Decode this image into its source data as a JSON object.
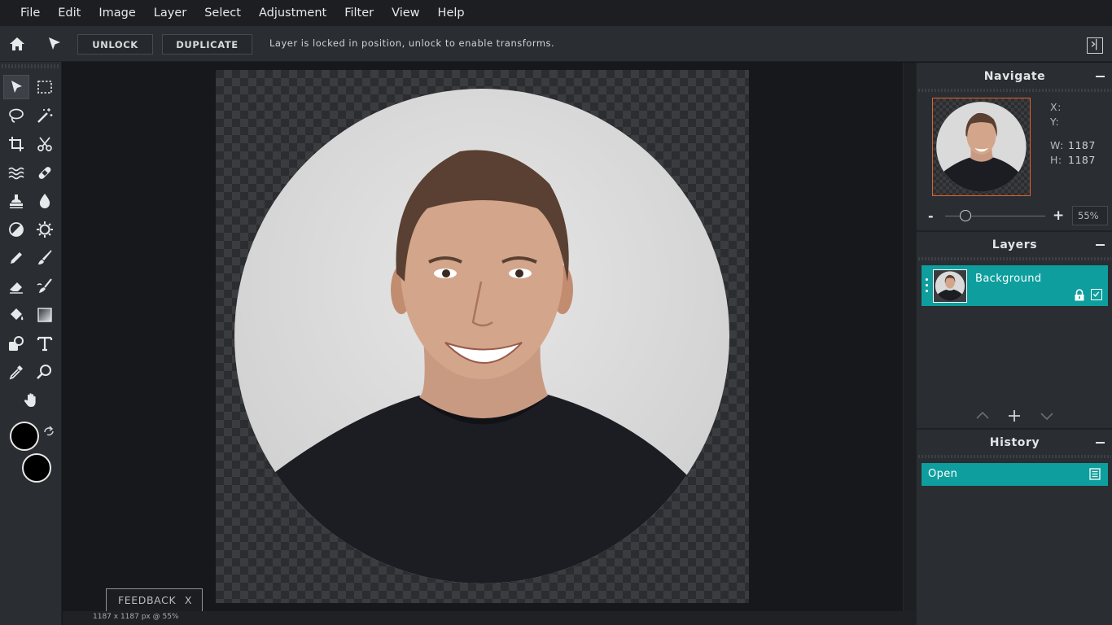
{
  "menu": [
    "File",
    "Edit",
    "Image",
    "Layer",
    "Select",
    "Adjustment",
    "Filter",
    "View",
    "Help"
  ],
  "options": {
    "unlock_label": "UNLOCK",
    "duplicate_label": "DUPLICATE",
    "message": "Layer is locked in position, unlock to enable transforms."
  },
  "tools": [
    {
      "name": "move-tool",
      "icon": "cursor-arrow-icon",
      "active": true
    },
    {
      "name": "marquee-tool",
      "icon": "dashed-rect-icon"
    },
    {
      "name": "lasso-tool",
      "icon": "lasso-icon"
    },
    {
      "name": "magic-wand-tool",
      "icon": "magic-wand-icon"
    },
    {
      "name": "crop-tool",
      "icon": "crop-icon"
    },
    {
      "name": "cut-tool",
      "icon": "scissors-icon"
    },
    {
      "name": "liquify-tool",
      "icon": "waves-icon"
    },
    {
      "name": "heal-tool",
      "icon": "bandage-icon"
    },
    {
      "name": "clone-stamp-tool",
      "icon": "stamp-icon"
    },
    {
      "name": "blur-tool",
      "icon": "drop-icon"
    },
    {
      "name": "dodge-tool",
      "icon": "half-circle-icon"
    },
    {
      "name": "sponge-tool",
      "icon": "sun-gear-icon"
    },
    {
      "name": "pencil-tool",
      "icon": "pencil-icon"
    },
    {
      "name": "brush-tool",
      "icon": "brush-icon"
    },
    {
      "name": "eraser-tool",
      "icon": "eraser-icon"
    },
    {
      "name": "smudge-tool",
      "icon": "smudge-brush-icon"
    },
    {
      "name": "fill-tool",
      "icon": "paint-bucket-icon"
    },
    {
      "name": "gradient-tool",
      "icon": "gradient-icon"
    },
    {
      "name": "shape-tool",
      "icon": "shapes-icon"
    },
    {
      "name": "text-tool",
      "icon": "text-icon"
    },
    {
      "name": "eyedropper-tool",
      "icon": "eyedropper-icon"
    },
    {
      "name": "zoom-tool",
      "icon": "magnifier-icon"
    },
    {
      "name": "hand-tool",
      "icon": "hand-icon"
    }
  ],
  "colors": {
    "foreground": "#000000",
    "background": "#000000",
    "accent": "#0e9e9e",
    "nav_frame": "#e0632a"
  },
  "status": "1187 x 1187 px @ 55%",
  "feedback": {
    "label": "FEEDBACK",
    "close": "X"
  },
  "navigate": {
    "title": "Navigate",
    "x_label": "X:",
    "x_value": "",
    "y_label": "Y:",
    "y_value": "",
    "w_label": "W:",
    "w_value": "1187",
    "h_label": "H:",
    "h_value": "1187",
    "zoom_minus": "-",
    "zoom_plus": "+",
    "zoom_value": "55%",
    "zoom_level": 0.2
  },
  "layers": {
    "title": "Layers",
    "items": [
      {
        "name": "Background",
        "locked": true,
        "visible": true
      }
    ]
  },
  "history": {
    "title": "History",
    "items": [
      {
        "name": "Open"
      }
    ]
  }
}
